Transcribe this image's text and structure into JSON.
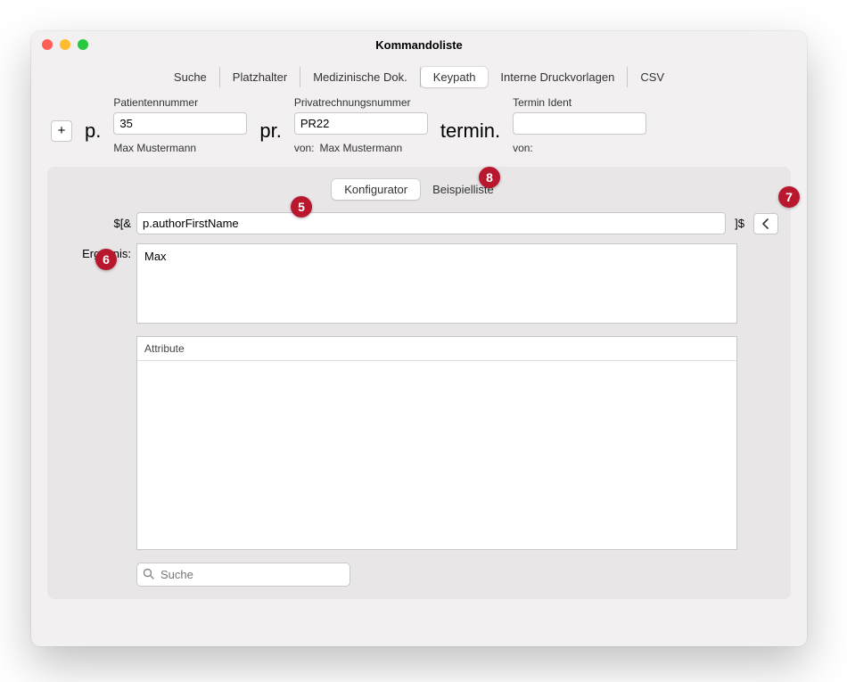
{
  "window": {
    "title": "Kommandoliste"
  },
  "mainTabs": {
    "items": [
      "Suche",
      "Platzhalter",
      "Medizinische Dok.",
      "Keypath",
      "Interne Druckvorlagen",
      "CSV"
    ],
    "activeIndex": 3
  },
  "form": {
    "plus": "+",
    "patient": {
      "label": "Patientennummer",
      "prefix": "p.",
      "value": "35",
      "below": "Max Mustermann"
    },
    "pr": {
      "label": "Privatrechnungsnummer",
      "prefix": "pr.",
      "value": "PR22",
      "below_label": "von:",
      "below_value": "Max Mustermann"
    },
    "termin": {
      "label": "Termin Ident",
      "prefix": "termin.",
      "value": "",
      "below_label": "von:"
    }
  },
  "subTabs": {
    "items": [
      "Konfigurator",
      "Beispielliste"
    ],
    "activeIndex": 0
  },
  "keypath": {
    "prefix": "$[&",
    "value": "p.authorFirstName",
    "suffix": "]$"
  },
  "result": {
    "label": "Ergebnis:",
    "value": "Max"
  },
  "attributes": {
    "header": "Attribute"
  },
  "search": {
    "placeholder": "Suche"
  },
  "callouts": {
    "c5": "5",
    "c6": "6",
    "c7": "7",
    "c8": "8"
  }
}
